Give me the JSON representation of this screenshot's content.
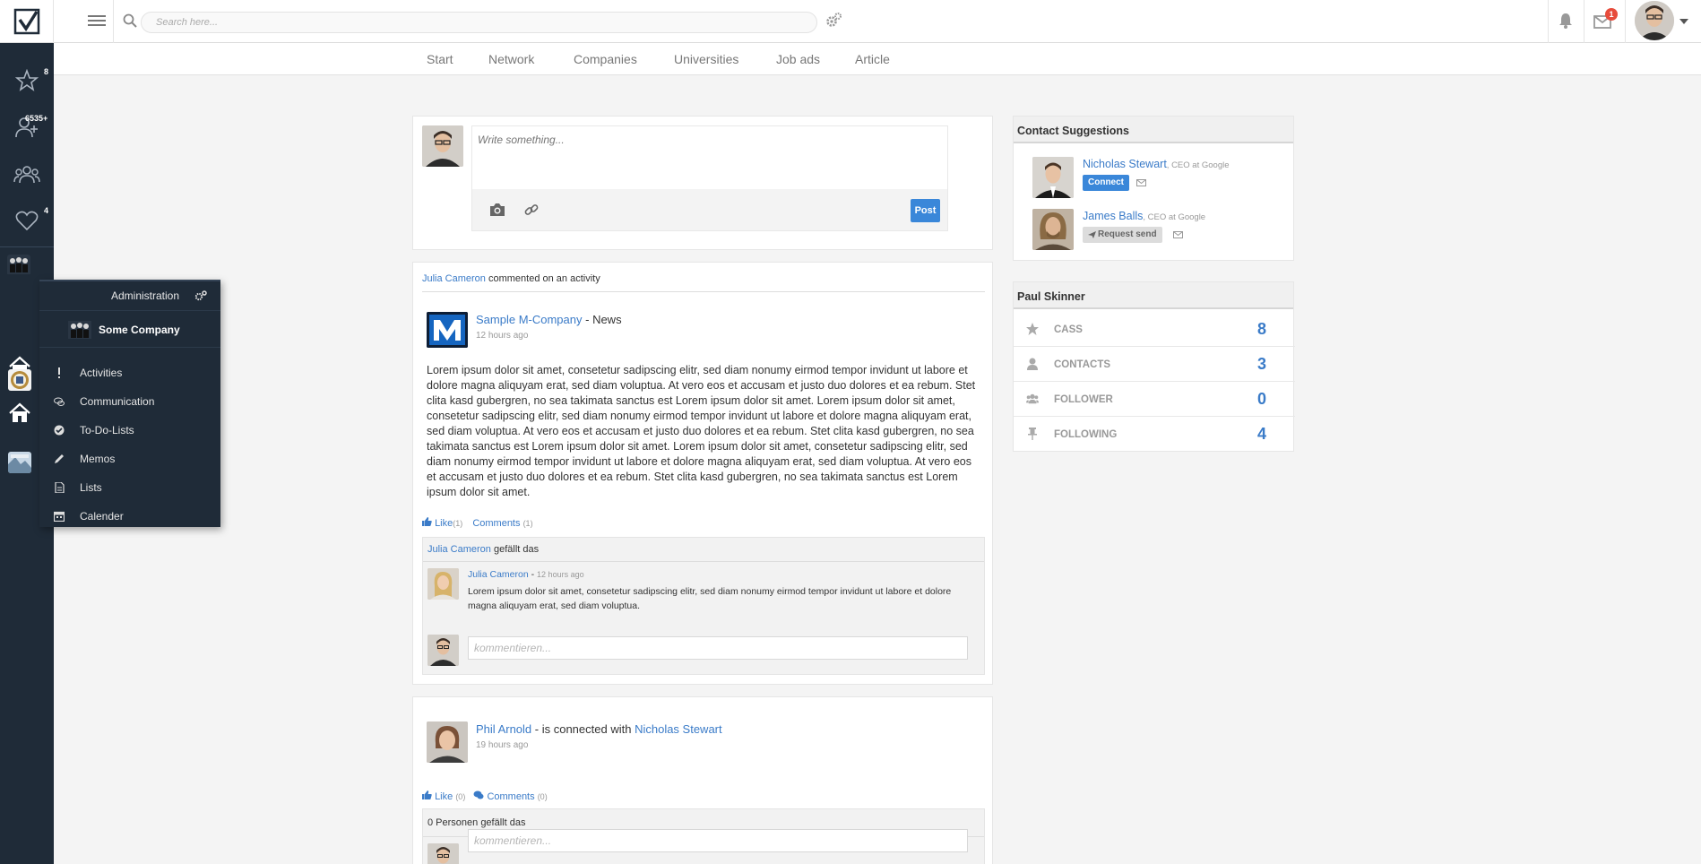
{
  "search": {
    "placeholder": "Search here..."
  },
  "header": {
    "mail_count": "1"
  },
  "nav": {
    "tabs": [
      "Start",
      "Network",
      "Companies",
      "Universities",
      "Job ads",
      "Article"
    ]
  },
  "sidebar": {
    "badges": {
      "favorites": "8",
      "contacts": "6535+",
      "likes": "4"
    }
  },
  "menu": {
    "title": "Administration",
    "company": "Some Company",
    "items": [
      "Activities",
      "Communication",
      "To-Do-Lists",
      "Memos",
      "Lists",
      "Calender"
    ]
  },
  "composer": {
    "placeholder": "Write something...",
    "post_label": "Post"
  },
  "activity1": {
    "actor": "Julia Cameron",
    "action": "commented on an activity",
    "source": "Sample M-Company",
    "source_type": "- News",
    "time": "12 hours ago",
    "body": "Lorem ipsum dolor sit amet, consetetur sadipscing elitr, sed diam nonumy eirmod tempor invidunt ut labore et dolore magna aliquyam erat, sed diam voluptua. At vero eos et accusam et justo duo dolores et ea rebum. Stet clita kasd gubergren, no sea takimata sanctus est Lorem ipsum dolor sit amet. Lorem ipsum dolor sit amet, consetetur sadipscing elitr, sed diam nonumy eirmod tempor invidunt ut labore et dolore magna aliquyam erat, sed diam voluptua. At vero eos et accusam et justo duo dolores et ea rebum. Stet clita kasd gubergren, no sea takimata sanctus est Lorem ipsum dolor sit amet. Lorem ipsum dolor sit amet, consetetur sadipscing elitr, sed diam nonumy eirmod tempor invidunt ut labore et dolore magna aliquyam erat, sed diam voluptua. At vero eos et accusam et justo duo dolores et ea rebum. Stet clita kasd gubergren, no sea takimata sanctus est Lorem ipsum dolor sit amet.",
    "like_label": "Like",
    "like_count": "(1)",
    "comments_label": "Comments",
    "comments_count": "(1)",
    "liked_by": "Julia Cameron",
    "liked_suffix": "gefällt das",
    "comment": {
      "author": "Julia Cameron",
      "time": "12 hours ago",
      "text": "Lorem ipsum dolor sit amet, consetetur sadipscing elitr, sed diam nonumy eirmod tempor invidunt ut labore et dolore magna aliquyam erat, sed diam voluptua."
    },
    "comment_placeholder": "kommentieren..."
  },
  "activity2": {
    "actor": "Phil Arnold",
    "action": "- is connected with",
    "target": "Nicholas Stewart",
    "time": "19 hours ago",
    "like_label": "Like",
    "like_count": "(0)",
    "comments_label": "Comments",
    "comments_count": "(0)",
    "liked_text": "0 Personen gefällt das",
    "comment_placeholder": "kommentieren..."
  },
  "suggestions": {
    "title": "Contact Suggestions",
    "people": [
      {
        "name": "Nicholas Stewart",
        "role": ", CEO at Google",
        "action": "Connect"
      },
      {
        "name": "James Balls",
        "role": ", CEO at Google",
        "action": "Request send"
      }
    ]
  },
  "profile": {
    "name": "Paul Skinner",
    "stats": [
      {
        "label": "CASS",
        "value": "8"
      },
      {
        "label": "CONTACTS",
        "value": "3"
      },
      {
        "label": "FOLLOWER",
        "value": "0"
      },
      {
        "label": "FOLLOWING",
        "value": "4"
      }
    ]
  },
  "colors": {
    "accent": "#3a87d9",
    "sidebar": "#1f2b38",
    "badge": "#e74c3c"
  }
}
